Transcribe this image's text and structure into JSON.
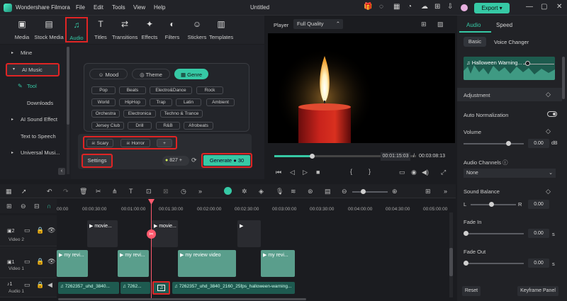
{
  "app": {
    "title": "Wondershare Filmora",
    "document": "Untitled",
    "menus": [
      "File",
      "Edit",
      "Tools",
      "View",
      "Help"
    ],
    "export_label": "Export"
  },
  "toolbar": {
    "items": [
      "Media",
      "Stock Media",
      "Audio",
      "Titles",
      "Transitions",
      "Effects",
      "Filters",
      "Stickers",
      "Templates"
    ]
  },
  "sidebar": {
    "items": [
      {
        "label": "Mine"
      },
      {
        "label": "AI Music"
      },
      {
        "label": "Tool"
      },
      {
        "label": "Downloads"
      },
      {
        "label": "AI Sound Effect"
      },
      {
        "label": "Text to Speech"
      },
      {
        "label": "Universal Musi..."
      }
    ]
  },
  "ai_music": {
    "tabs": [
      "Mood",
      "Theme",
      "Genre"
    ],
    "genres": [
      "Pop",
      "Beats",
      "Electro&Dance",
      "Rock",
      "World",
      "HipHop",
      "Trap",
      "Latin",
      "Ambient",
      "Orchestra",
      "Electronica",
      "Techno & Trance",
      "Jersey Club",
      "Drill",
      "R&B",
      "Afrobeats"
    ],
    "selected_tags": [
      "Scary",
      "Horror"
    ],
    "add_label": "+",
    "settings_label": "Settings",
    "credits": "827",
    "generate_label": "Generate",
    "generate_cost": "30"
  },
  "player": {
    "label": "Player",
    "quality": "Full Quality",
    "current_time": "00:01:15:03",
    "total_time": "00:03:08:13"
  },
  "right_panel": {
    "tabs": [
      "Audio",
      "Speed"
    ],
    "subtabs": [
      "Basic",
      "Voice Changer"
    ],
    "waveform_title": "Halloween Warning...",
    "adjustment": "Adjustment",
    "auto_normalization": "Auto Normalization",
    "volume": "Volume",
    "volume_value": "0.00",
    "volume_unit": "dB",
    "audio_channels": "Audio Channels",
    "channels_value": "None",
    "sound_balance": "Sound Balance",
    "balance_l": "L",
    "balance_r": "R",
    "balance_value": "0.00",
    "fade_in": "Fade In",
    "fade_in_value": "0.00",
    "fade_in_unit": "s",
    "fade_out": "Fade Out",
    "fade_out_value": "0.00",
    "fade_out_unit": "s",
    "reset_label": "Reset",
    "keyframe_label": "Keyframe Panel"
  },
  "timeline": {
    "ruler": [
      "00:00",
      "00:00:30:00",
      "00:01:00:00",
      "00:01:30:00",
      "00:02:00:00",
      "00:02:30:00",
      "00:03:00:00",
      "00:03:30:00",
      "00:04:00:00",
      "00:04:30:00",
      "00:05:00:00"
    ],
    "tracks": [
      {
        "label": "Video 2",
        "num": "2"
      },
      {
        "label": "Video 1",
        "num": "1"
      },
      {
        "label": "Audio 1",
        "num": "1"
      }
    ],
    "video2_clips": [
      "movie...",
      "movie...",
      ""
    ],
    "video1_clips": [
      "my revi...",
      "my revi...",
      "my review video",
      "my revi..."
    ],
    "audio_clips": [
      "7262357_uhd_3840...",
      "7262...",
      "",
      "7262357_uhd_3840_2160_25fps_halloween-warning..."
    ]
  },
  "colors": {
    "accent": "#36c9a5",
    "highlight": "#e02424",
    "playhead": "#ff5a6e"
  }
}
